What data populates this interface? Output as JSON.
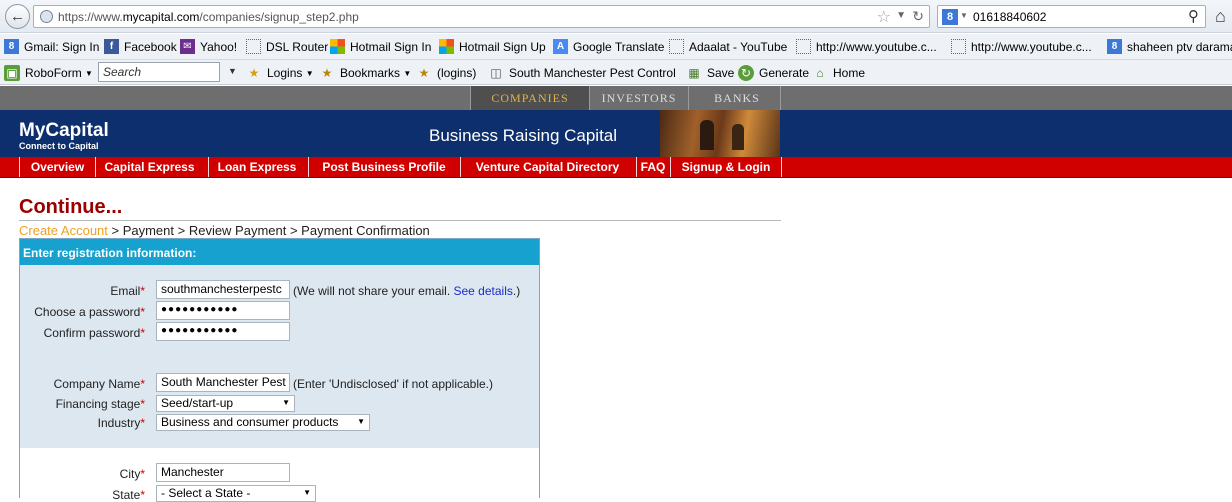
{
  "browser": {
    "url_prefix": "https://www.",
    "url_domain": "mycapital.com",
    "url_path": "/companies/signup_step2.php",
    "search_query": "01618840602",
    "bookmarks": [
      {
        "label": "Gmail: Sign In",
        "icon": "google-icon"
      },
      {
        "label": "Facebook",
        "icon": "facebook-icon"
      },
      {
        "label": "Yahoo!",
        "icon": "yahoo-icon"
      },
      {
        "label": "DSL Router",
        "icon": "blank-page-icon"
      },
      {
        "label": "Hotmail Sign In",
        "icon": "windows-icon"
      },
      {
        "label": "Hotmail Sign Up",
        "icon": "windows-icon"
      },
      {
        "label": "Google Translate",
        "icon": "translate-icon"
      },
      {
        "label": "Adaalat - YouTube",
        "icon": "blank-page-icon"
      },
      {
        "label": "http://www.youtube.c...",
        "icon": "blank-page-icon"
      },
      {
        "label": "http://www.youtube.c...",
        "icon": "blank-page-icon"
      },
      {
        "label": "shaheen ptv darama",
        "icon": "google-icon"
      }
    ],
    "toolbar": {
      "roboform": "RoboForm",
      "search_placeholder": "Search",
      "logins": "Logins",
      "bookmarks": "Bookmarks",
      "logins_paren": "(logins)",
      "site_name": "South Manchester Pest Control",
      "save": "Save",
      "generate": "Generate",
      "home": "Home"
    }
  },
  "site": {
    "top_tabs": [
      "COMPANIES",
      "INVESTORS",
      "BANKS"
    ],
    "logo_title": "MyCapital",
    "logo_tagline": "Connect to Capital",
    "banner_title": "Business Raising Capital",
    "nav": [
      "Overview",
      "Capital Express",
      "Loan Express",
      "Post Business Profile",
      "Venture Capital Directory",
      "FAQ",
      "Signup & Login"
    ],
    "heading": "Continue...",
    "steps": {
      "current": "Create Account",
      "rest": " > Payment > Review Payment > Payment Confirmation"
    },
    "form": {
      "header": "Enter registration information:",
      "email_label": "Email",
      "email_value": "southmanchesterpestc",
      "email_note": "(We will not share your email. ",
      "email_link": "See details",
      "email_note_end": ".)",
      "password_label": "Choose a password",
      "password_value": "●●●●●●●●●●●",
      "confirm_label": "Confirm password",
      "confirm_value": "●●●●●●●●●●●",
      "company_label": "Company Name",
      "company_value": "South Manchester Pest",
      "company_note": "(Enter 'Undisclosed' if not applicable.)",
      "stage_label": "Financing stage",
      "stage_value": "Seed/start-up",
      "industry_label": "Industry",
      "industry_value": "Business and consumer products",
      "city_label": "City",
      "city_value": "Manchester",
      "state_label": "State",
      "state_value": "- Select a State -",
      "required_mark": "*"
    }
  },
  "colors": {
    "banner_blue": "#0d2f6e",
    "nav_red": "#d00000",
    "heading_red": "#990000",
    "step_orange": "#f0a020",
    "panel_header": "#16a1cf",
    "section_bg": "#dde7f0"
  }
}
